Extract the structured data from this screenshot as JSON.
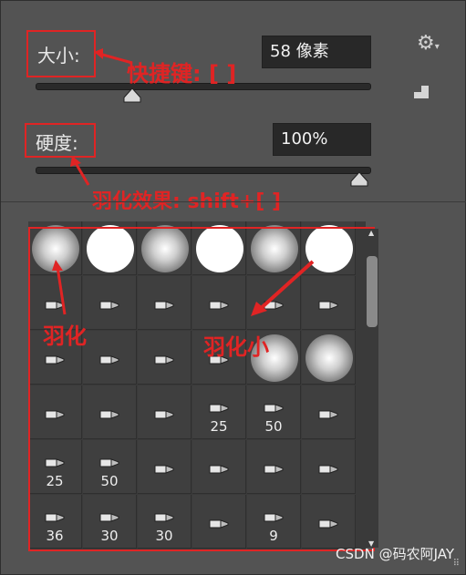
{
  "size": {
    "label": "大小:",
    "value": "58 像素",
    "slider_fraction": 0.29
  },
  "hardness": {
    "label": "硬度:",
    "value": "100%",
    "slider_fraction": 0.97
  },
  "annotations": {
    "shortcut": "快捷键: [ ]",
    "feather_effect": "羽化效果: shift+[ ]",
    "feather": "羽化",
    "feather_small": "羽化小"
  },
  "icons": {
    "settings": "gear-icon",
    "new_preset": "new-preset-icon",
    "scroll_up": "scroll-up-arrow-icon",
    "scroll_down": "scroll-down-arrow-icon",
    "resize": "resize-grip-icon"
  },
  "brushes": [
    {
      "kind": "soft",
      "label": ""
    },
    {
      "kind": "hard",
      "label": ""
    },
    {
      "kind": "soft",
      "label": ""
    },
    {
      "kind": "hard",
      "label": ""
    },
    {
      "kind": "soft",
      "label": ""
    },
    {
      "kind": "hard",
      "label": ""
    },
    {
      "kind": "tip",
      "label": ""
    },
    {
      "kind": "tip",
      "label": ""
    },
    {
      "kind": "tip",
      "label": ""
    },
    {
      "kind": "tip",
      "label": ""
    },
    {
      "kind": "tip",
      "label": ""
    },
    {
      "kind": "tip",
      "label": ""
    },
    {
      "kind": "tip",
      "label": ""
    },
    {
      "kind": "tip",
      "label": ""
    },
    {
      "kind": "tip",
      "label": ""
    },
    {
      "kind": "tip",
      "label": ""
    },
    {
      "kind": "soft",
      "label": ""
    },
    {
      "kind": "soft",
      "label": ""
    },
    {
      "kind": "tip",
      "label": ""
    },
    {
      "kind": "tip",
      "label": ""
    },
    {
      "kind": "tip",
      "label": ""
    },
    {
      "kind": "tip",
      "label": "25"
    },
    {
      "kind": "tip",
      "label": "50"
    },
    {
      "kind": "tip",
      "label": ""
    },
    {
      "kind": "tip",
      "label": "25"
    },
    {
      "kind": "tip",
      "label": "50"
    },
    {
      "kind": "tip",
      "label": ""
    },
    {
      "kind": "tip",
      "label": ""
    },
    {
      "kind": "tip",
      "label": ""
    },
    {
      "kind": "tip",
      "label": ""
    },
    {
      "kind": "tip",
      "label": "36"
    },
    {
      "kind": "tip",
      "label": "30"
    },
    {
      "kind": "tip",
      "label": "30"
    },
    {
      "kind": "tip",
      "label": ""
    },
    {
      "kind": "tip",
      "label": "9"
    },
    {
      "kind": "tip",
      "label": ""
    }
  ],
  "watermark": "CSDN @码农阿JAY",
  "colors": {
    "annotation_red": "#e02424",
    "panel_bg": "#535353",
    "field_bg": "#282828"
  }
}
